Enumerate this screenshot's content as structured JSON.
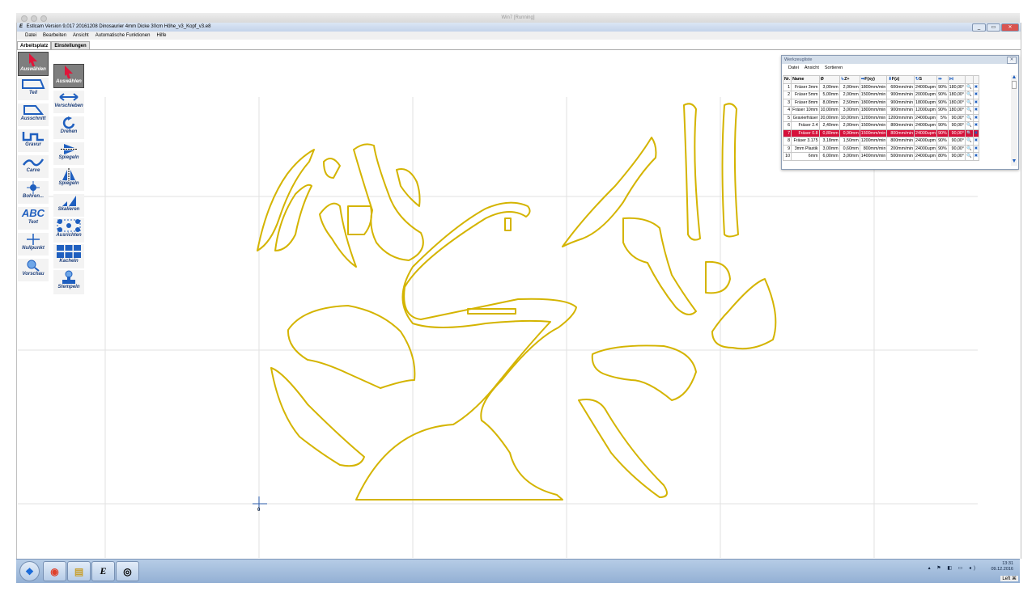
{
  "outer_window": {
    "title": "Win7 [Running]"
  },
  "app": {
    "title": "Estlcam Version 9,017 20161208 Dinosaurier 4mm Dicke 30cm Höhe_v3_Kopf_v3.e8"
  },
  "window_buttons": {
    "minimize": "_",
    "restore": "▭",
    "close": "✕"
  },
  "menu": [
    "Datei",
    "Bearbeiten",
    "Ansicht",
    "Automatische Funktionen",
    "Hilfe"
  ],
  "tabs": [
    "Arbeitsplatz",
    "Einstellungen"
  ],
  "left_tools": [
    "Auswählen",
    "Teil",
    "Ausschnitt",
    "Gravur",
    "Carve",
    "Bohren...",
    "Text",
    "Nullpunkt",
    "Vorschau"
  ],
  "text_tool_glyph": "ABC",
  "right_tools": [
    "Auswählen",
    "Verschieben",
    "Drehen",
    "Spiegeln",
    "Spiegeln",
    "Skalieren",
    "Ausrichten",
    "Kacheln",
    "Stempeln"
  ],
  "origin_label": "0",
  "tool_list": {
    "title": "Werkzeugliste",
    "close": "✕",
    "menu": [
      "Datei",
      "Ansicht",
      "Sortieren"
    ],
    "columns": [
      "Nr.",
      "Name",
      "Ø",
      "Z+",
      "F(xy)",
      "F(z)",
      "S",
      "",
      "",
      "",
      ""
    ],
    "rows": [
      [
        "1",
        "Fräser 3mm",
        "3,00mm",
        "2,00mm",
        "1800mm/min",
        "600mm/min",
        "24000upm",
        "90%",
        "180,00°"
      ],
      [
        "2",
        "Fräser 5mm",
        "5,00mm",
        "2,00mm",
        "1500mm/min",
        "900mm/min",
        "20000upm",
        "90%",
        "180,00°"
      ],
      [
        "3",
        "Fräser 8mm",
        "8,00mm",
        "2,50mm",
        "1800mm/min",
        "900mm/min",
        "18000upm",
        "90%",
        "180,00°"
      ],
      [
        "4",
        "Fräser 10mm",
        "10,00mm",
        "3,00mm",
        "1800mm/min",
        "900mm/min",
        "12000upm",
        "90%",
        "180,00°"
      ],
      [
        "5",
        "Gravierfräser",
        "20,00mm",
        "10,00mm",
        "1200mm/min",
        "1200mm/min",
        "24000upm",
        "5%",
        "90,00°"
      ],
      [
        "6",
        "Fräser 2.4",
        "2,40mm",
        "2,00mm",
        "1500mm/min",
        "800mm/min",
        "24000upm",
        "90%",
        "90,00°"
      ],
      [
        "7",
        "Fräser 0.8",
        "0,80mm",
        "0,90mm",
        "1500mm/min",
        "800mm/min",
        "24000upm",
        "90%",
        "90,00°"
      ],
      [
        "8",
        "Fräser 3.175",
        "3,18mm",
        "1,50mm",
        "1200mm/min",
        "800mm/min",
        "24000upm",
        "90%",
        "90,00°"
      ],
      [
        "9",
        "3mm Plastik",
        "3,00mm",
        "0,60mm",
        "800mm/min",
        "200mm/min",
        "24000upm",
        "90%",
        "90,00°"
      ],
      [
        "10",
        "6mm",
        "6,00mm",
        "3,00mm",
        "1400mm/min",
        "500mm/min",
        "24000upm",
        "80%",
        "90,00°"
      ]
    ],
    "selected_row": "7",
    "row_icons": {
      "search": "🔍",
      "delete": "✖"
    }
  },
  "taskbar": {
    "start": "❖",
    "chrome": "◉",
    "explorer": "▤",
    "estlcam": "E",
    "app5": "◎"
  },
  "clock": {
    "time": "13:31",
    "date": "09.12.2016"
  },
  "tray": "▴ ⚑ ◧ ▭ ◂)",
  "vm_status": "Left ⌘",
  "colors": {
    "accent_select": "#d6103a",
    "shape_outline": "#d4b400",
    "grid": "#e2e2e2",
    "toolbar_text": "#1e3f7a"
  }
}
